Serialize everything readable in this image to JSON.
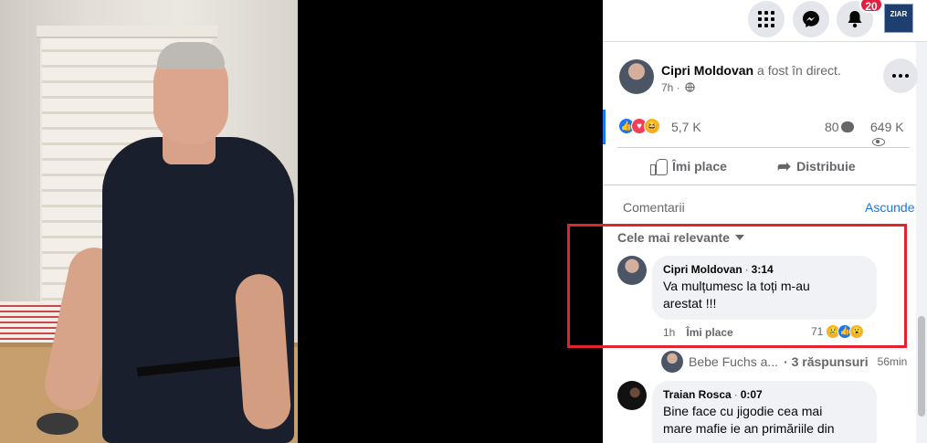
{
  "topbar": {
    "notification_count": "20",
    "profile_thumb_text": "ZIAR"
  },
  "post": {
    "author": "Cipri Moldovan",
    "action": "a fost în direct.",
    "time": "7h ·",
    "reactions_count": "5,7 K",
    "comments_count": "80",
    "views_count": "649 K",
    "like_label": "Îmi place",
    "share_label": "Distribuie"
  },
  "comments_section": {
    "title": "Comentarii",
    "hide_label": "Ascunde",
    "sort_label": "Cele mai relevante",
    "comments": [
      {
        "author": "Cipri Moldovan",
        "stamp": "3:14",
        "text_line1": "Va mulțumesc la toți m-au",
        "text_line2": "arestat !!!",
        "age": "1h",
        "like_label": "Îmi place",
        "reaction_count": "71"
      },
      {
        "author": "Traian Rosca",
        "stamp": "0:07",
        "text_line1": "Bine face cu jigodie cea mai",
        "text_line2": "mare mafie ie an primăriile din"
      }
    ],
    "replies": {
      "preview": "Bebe Fuchs a...",
      "count_label": "· 3 răspunsuri",
      "age": "56min"
    }
  },
  "colors": {
    "accent": "#1877f2",
    "highlight_border": "#e3222b",
    "badge": "#e41e3f"
  },
  "icons": [
    "menu-grid-icon",
    "messenger-icon",
    "bell-icon",
    "globe-icon",
    "more-icon",
    "like-reaction-icon",
    "love-reaction-icon",
    "haha-reaction-icon",
    "comment-icon",
    "eye-icon",
    "thumbs-up-icon",
    "share-icon",
    "caret-down-icon"
  ]
}
